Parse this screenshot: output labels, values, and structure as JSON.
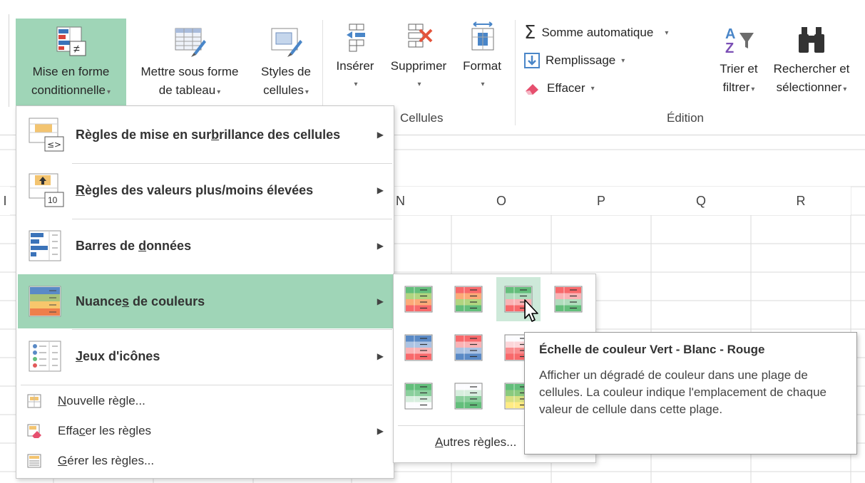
{
  "ribbon": {
    "styles_group": {
      "conditional_formatting": {
        "line1": "Mise en forme",
        "line2": "conditionnelle",
        "caret": "▾",
        "icon": "conditional-formatting-icon"
      },
      "format_as_table": {
        "line1": "Mettre sous forme",
        "line2": "de tableau",
        "caret": "▾",
        "icon": "format-as-table-icon"
      },
      "cell_styles": {
        "line1": "Styles de",
        "line2": "cellules",
        "caret": "▾",
        "icon": "cell-styles-icon"
      }
    },
    "cells_group": {
      "label": "Cellules",
      "insert": {
        "label": "Insérer",
        "caret": "▾",
        "icon": "insert-cells-icon"
      },
      "delete": {
        "label": "Supprimer",
        "caret": "▾",
        "icon": "delete-cells-icon"
      },
      "format": {
        "label": "Format",
        "caret": "▾",
        "icon": "format-cells-icon"
      }
    },
    "editing_group": {
      "label": "Édition",
      "autosum": {
        "label": "Somme automatique",
        "caret": "▾",
        "icon": "sigma-icon"
      },
      "fill": {
        "label": "Remplissage",
        "caret": "▾",
        "icon": "fill-down-icon"
      },
      "clear": {
        "label": "Effacer",
        "caret": "▾",
        "icon": "eraser-icon"
      },
      "sort_filter": {
        "line1": "Trier et",
        "line2": "filtrer",
        "caret": "▾",
        "icon": "sort-filter-icon"
      },
      "find_select": {
        "line1": "Rechercher et",
        "line2": "sélectionner",
        "caret": "▾",
        "icon": "binoculars-icon"
      }
    }
  },
  "sheet": {
    "columns": [
      "N",
      "O",
      "P",
      "Q",
      "R"
    ],
    "partial_column_left": "I"
  },
  "menu": {
    "items": [
      {
        "label_pre": "Règles de mise en sur",
        "label_u": "b",
        "label_post": "rillance des cellules",
        "icon": "highlight-cells-rules-icon"
      },
      {
        "label_pre": "",
        "label_u": "R",
        "label_post": "ègles des valeurs plus/moins élevées",
        "icon": "top-bottom-rules-icon"
      },
      {
        "label_pre": "Barres de ",
        "label_u": "d",
        "label_post": "onnées",
        "icon": "data-bars-icon"
      },
      {
        "label_pre": "Nuance",
        "label_u": "s",
        "label_post": " de couleurs",
        "icon": "color-scales-icon"
      },
      {
        "label_pre": "",
        "label_u": "J",
        "label_post": "eux d'icônes",
        "icon": "icon-sets-icon"
      }
    ],
    "small_items": [
      {
        "label_pre": "",
        "label_u": "N",
        "label_post": "ouvelle règle...",
        "icon": "new-rule-icon"
      },
      {
        "label_pre": "Effa",
        "label_u": "c",
        "label_post": "er les règles",
        "icon": "clear-rules-icon"
      },
      {
        "label_pre": "",
        "label_u": "G",
        "label_post": "érer les règles...",
        "icon": "manage-rules-icon"
      }
    ],
    "highlight_color": "#9fd5b7"
  },
  "submenu": {
    "more_rules_u": "A",
    "more_rules_post": "utres règles...",
    "swatches": [
      {
        "name": "green-yellow-red",
        "colors": [
          "#63be7b",
          "#ffeb84",
          "#f8696b"
        ]
      },
      {
        "name": "red-yellow-green",
        "colors": [
          "#f8696b",
          "#ffeb84",
          "#63be7b"
        ]
      },
      {
        "name": "green-white-red",
        "colors": [
          "#63be7b",
          "#fcfcff",
          "#f8696b"
        ]
      },
      {
        "name": "red-white-green",
        "colors": [
          "#f8696b",
          "#fcfcff",
          "#63be7b"
        ]
      },
      {
        "name": "blue-white-red",
        "colors": [
          "#5a8ac6",
          "#fcfcff",
          "#f8696b"
        ]
      },
      {
        "name": "red-white-blue",
        "colors": [
          "#f8696b",
          "#fcfcff",
          "#5a8ac6"
        ]
      },
      {
        "name": "white-red",
        "colors": [
          "#fcfcff",
          "#fcb0b2",
          "#f8696b"
        ]
      },
      {
        "name": "red-white",
        "colors": [
          "#f8696b",
          "#fcb0b2",
          "#fcfcff"
        ]
      },
      {
        "name": "green-white",
        "colors": [
          "#63be7b",
          "#b1dfbc",
          "#fcfcff"
        ]
      },
      {
        "name": "white-green",
        "colors": [
          "#fcfcff",
          "#b1dfbc",
          "#63be7b"
        ]
      },
      {
        "name": "green-yellow",
        "colors": [
          "#63be7b",
          "#b1d580",
          "#ffeb84"
        ]
      },
      {
        "name": "yellow-green",
        "colors": [
          "#ffeb84",
          "#b1d580",
          "#63be7b"
        ]
      }
    ]
  },
  "tooltip": {
    "title": "Échelle de couleur Vert - Blanc - Rouge",
    "body": "Afficher un dégradé de couleur dans une plage de cellules. La couleur indique l'emplacement de chaque valeur de cellule dans cette plage."
  }
}
